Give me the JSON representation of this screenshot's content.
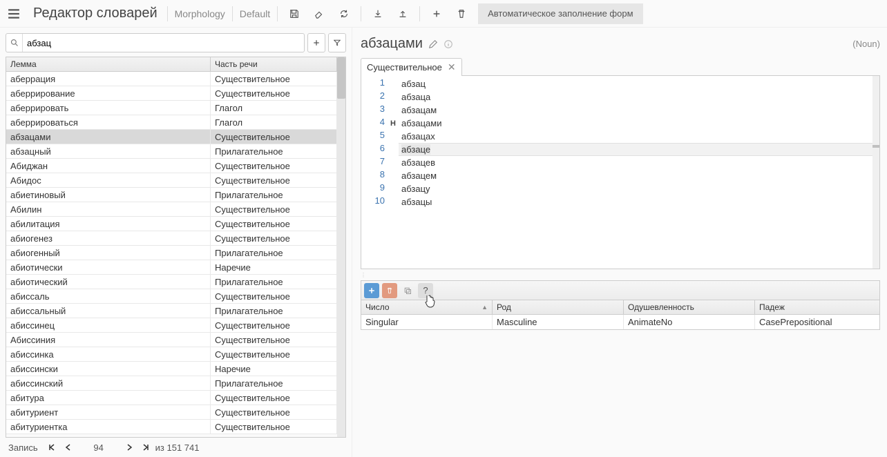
{
  "header": {
    "title": "Редактор словарей",
    "breadcrumb1": "Morphology",
    "breadcrumb2": "Default",
    "autofill": "Автоматическое заполнение форм"
  },
  "search": {
    "value": "абзац"
  },
  "grid": {
    "cols": {
      "lemma": "Лемма",
      "pos": "Часть речи"
    },
    "rows": [
      {
        "lemma": "аберрация",
        "pos": "Существительное"
      },
      {
        "lemma": "аберрирование",
        "pos": "Существительное"
      },
      {
        "lemma": "аберрировать",
        "pos": "Глагол"
      },
      {
        "lemma": "аберрироваться",
        "pos": "Глагол"
      },
      {
        "lemma": "абзацами",
        "pos": "Существительное",
        "selected": true
      },
      {
        "lemma": "абзацный",
        "pos": "Прилагательное"
      },
      {
        "lemma": "Абиджан",
        "pos": "Существительное"
      },
      {
        "lemma": "Абидос",
        "pos": "Существительное"
      },
      {
        "lemma": "абиетиновый",
        "pos": "Прилагательное"
      },
      {
        "lemma": "Абилин",
        "pos": "Существительное"
      },
      {
        "lemma": "абилитация",
        "pos": "Существительное"
      },
      {
        "lemma": "абиогенез",
        "pos": "Существительное"
      },
      {
        "lemma": "абиогенный",
        "pos": "Прилагательное"
      },
      {
        "lemma": "абиотически",
        "pos": "Наречие"
      },
      {
        "lemma": "абиотический",
        "pos": "Прилагательное"
      },
      {
        "lemma": "абиссаль",
        "pos": "Существительное"
      },
      {
        "lemma": "абиссальный",
        "pos": "Прилагательное"
      },
      {
        "lemma": "абиссинец",
        "pos": "Существительное"
      },
      {
        "lemma": "Абиссиния",
        "pos": "Существительное"
      },
      {
        "lemma": "абиссинка",
        "pos": "Существительное"
      },
      {
        "lemma": "абиссински",
        "pos": "Наречие"
      },
      {
        "lemma": "абиссинский",
        "pos": "Прилагательное"
      },
      {
        "lemma": "абитура",
        "pos": "Существительное"
      },
      {
        "lemma": "абитуриент",
        "pos": "Существительное"
      },
      {
        "lemma": "абитуриентка",
        "pos": "Существительное"
      }
    ]
  },
  "pager": {
    "label": "Запись",
    "current": "94",
    "total_label": "из 151 741"
  },
  "content": {
    "title": "абзацами",
    "pos_short": "(Noun)",
    "tab_label": "Существительное",
    "lines": [
      {
        "n": "1",
        "text": "абзац"
      },
      {
        "n": "2",
        "text": "абзаца"
      },
      {
        "n": "3",
        "text": "абзацам"
      },
      {
        "n": "4",
        "text": "абзацами",
        "marker": "H"
      },
      {
        "n": "5",
        "text": "абзацах"
      },
      {
        "n": "6",
        "text": "абзаце",
        "hover": true
      },
      {
        "n": "7",
        "text": "абзацев"
      },
      {
        "n": "8",
        "text": "абзацем"
      },
      {
        "n": "9",
        "text": "абзацу"
      },
      {
        "n": "10",
        "text": "абзацы"
      }
    ]
  },
  "attrs": {
    "cols": {
      "number": "Число",
      "gender": "Род",
      "animacy": "Одушевленность",
      "case": "Падеж"
    },
    "row": {
      "number": "Singular",
      "gender": "Masculine",
      "animacy": "AnimateNo",
      "case": "CasePrepositional"
    },
    "help": "?"
  }
}
